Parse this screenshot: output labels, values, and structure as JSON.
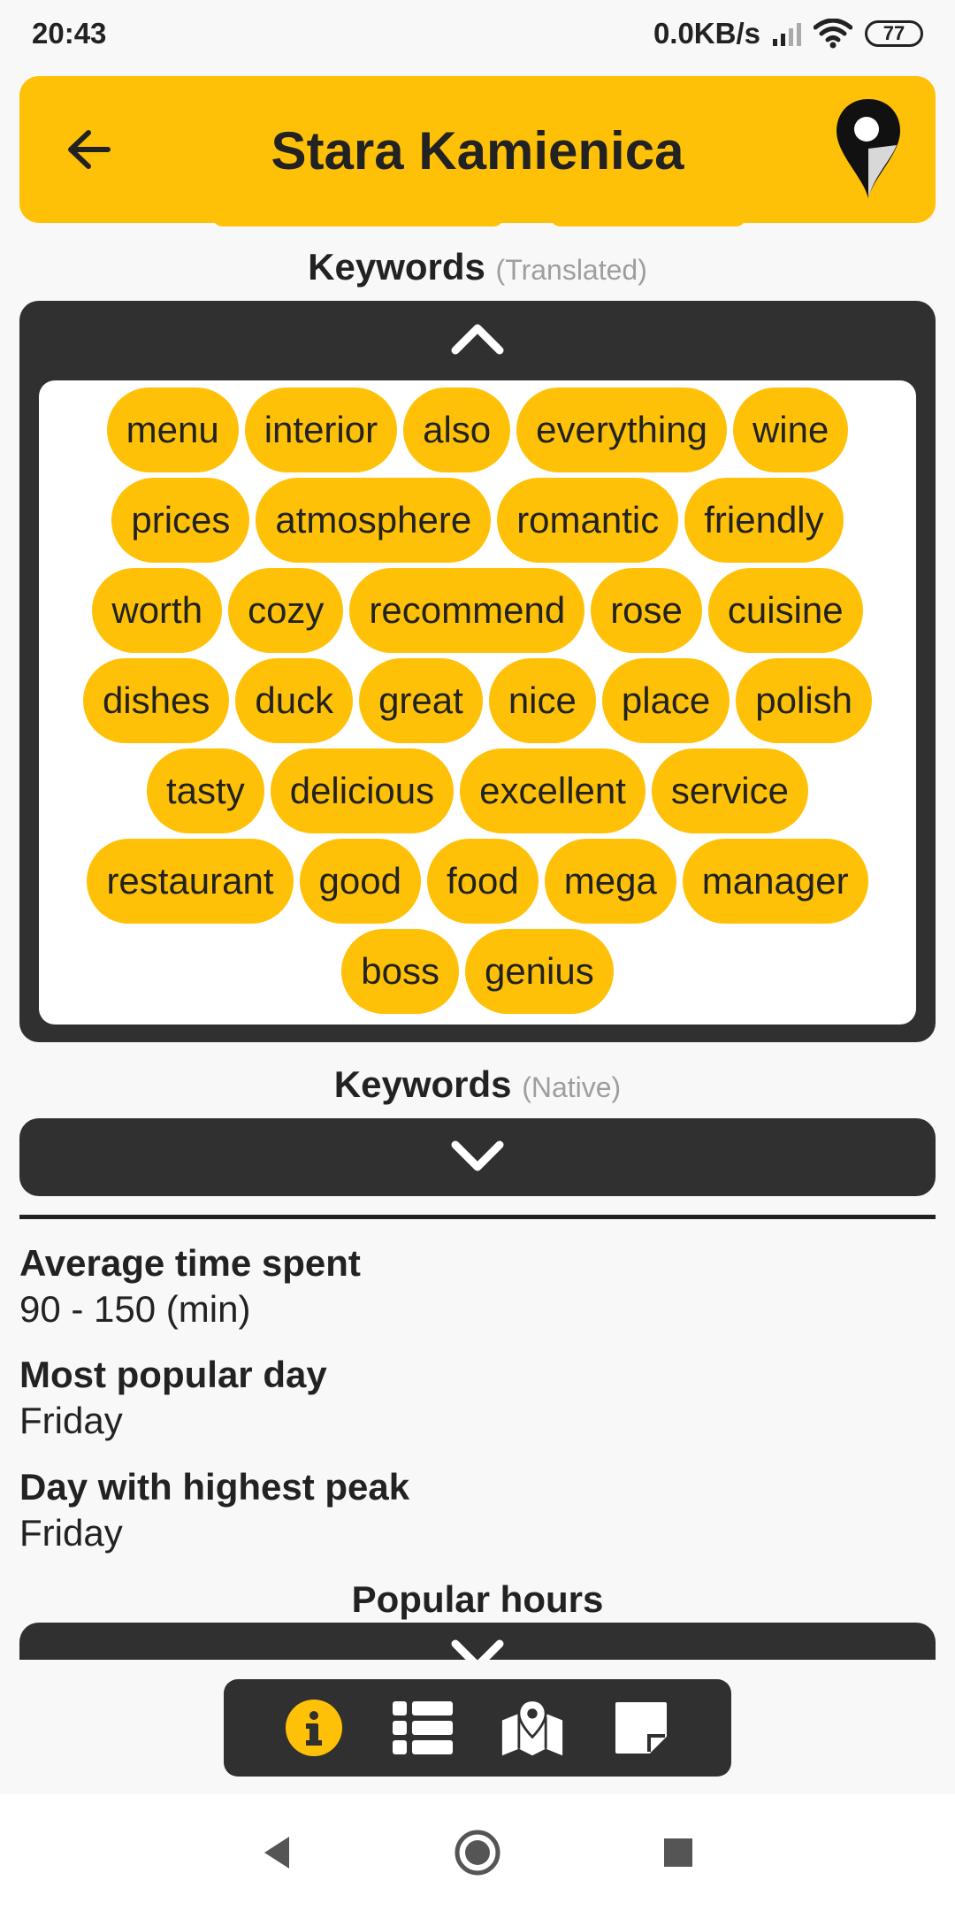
{
  "status_bar": {
    "time": "20:43",
    "network_speed": "0.0KB/s",
    "battery": "77"
  },
  "header": {
    "title": "Stara Kamienica"
  },
  "keywords_translated": {
    "title": "Keywords",
    "subtitle": "(Translated)",
    "rows": [
      [
        "menu",
        "interior",
        "also",
        "everything",
        "wine"
      ],
      [
        "prices",
        "atmosphere",
        "romantic",
        "friendly"
      ],
      [
        "worth",
        "cozy",
        "recommend",
        "rose",
        "cuisine"
      ],
      [
        "dishes",
        "duck",
        "great",
        "nice",
        "place",
        "polish"
      ],
      [
        "tasty",
        "delicious",
        "excellent",
        "service"
      ],
      [
        "restaurant",
        "good",
        "food",
        "mega",
        "manager"
      ],
      [
        "boss",
        "genius"
      ]
    ]
  },
  "keywords_native": {
    "title": "Keywords",
    "subtitle": "(Native)"
  },
  "stats": {
    "avg_time_label": "Average time spent",
    "avg_time_value": "90 - 150 (min)",
    "popular_day_label": "Most popular day",
    "popular_day_value": "Friday",
    "peak_day_label": "Day with highest peak",
    "peak_day_value": "Friday"
  },
  "popular_hours": {
    "title": "Popular hours"
  },
  "bottom_nav": {
    "items": [
      "info-icon",
      "list-icon",
      "map-icon",
      "note-icon"
    ],
    "active": "info-icon"
  },
  "colors": {
    "accent": "#ffc107",
    "dark": "#303030",
    "background": "#f8f8f8"
  }
}
